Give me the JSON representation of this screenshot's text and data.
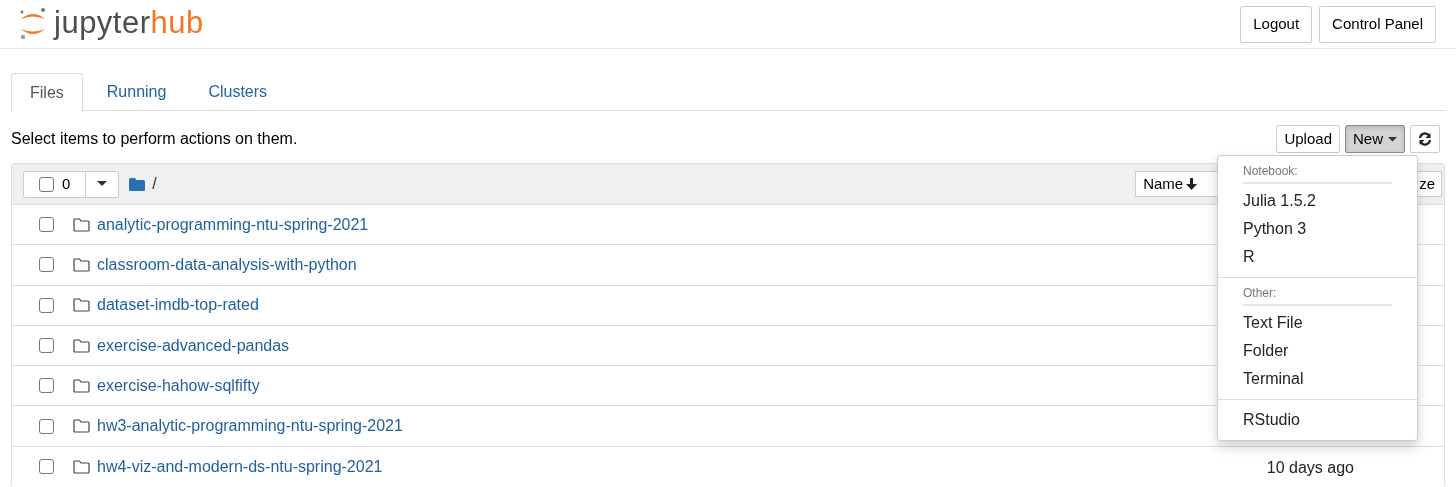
{
  "header": {
    "logo": {
      "part_1": "jupyter",
      "part_2": "hub"
    },
    "buttons": [
      "Logout",
      "Control Panel"
    ]
  },
  "tabs": [
    {
      "label": "Files",
      "selected": true
    },
    {
      "label": "Running",
      "selected": false
    },
    {
      "label": "Clusters",
      "selected": false
    }
  ],
  "toolbar": {
    "hint": "Select items to perform actions on them.",
    "buttons": [
      {
        "kind": "text",
        "label": "Upload",
        "pressed": false
      },
      {
        "kind": "menu",
        "label": "New",
        "pressed": true
      },
      {
        "kind": "refresh",
        "pressed": false
      }
    ]
  },
  "file_list": {
    "select_all": {
      "checked": false,
      "count": "0"
    },
    "path": "/",
    "sort_buttons": [
      {
        "label": "Name",
        "sorted": true
      },
      {
        "label": "ze",
        "sorted": false
      }
    ],
    "rows": [
      {
        "kind": "folder",
        "name": "analytic-programming-ntu-spring-2021",
        "checked": false
      },
      {
        "kind": "folder",
        "name": "classroom-data-analysis-with-python",
        "checked": false
      },
      {
        "kind": "folder",
        "name": "dataset-imdb-top-rated",
        "checked": false
      },
      {
        "kind": "folder",
        "name": "exercise-advanced-pandas",
        "checked": false
      },
      {
        "kind": "folder",
        "name": "exercise-hahow-sqlfifty",
        "checked": false
      },
      {
        "kind": "folder",
        "name": "hw3-analytic-programming-ntu-spring-2021",
        "checked": false
      },
      {
        "kind": "folder",
        "name": "hw4-viz-and-modern-ds-ntu-spring-2021",
        "checked": false,
        "modified": "10 days ago"
      }
    ]
  },
  "new_menu": {
    "sections": [
      {
        "header": "Notebook:",
        "items": [
          "Julia 1.5.2",
          "Python 3",
          "R"
        ]
      },
      {
        "header": "Other:",
        "items": [
          "Text File",
          "Folder",
          "Terminal"
        ]
      },
      {
        "items": [
          "RStudio"
        ]
      }
    ]
  }
}
